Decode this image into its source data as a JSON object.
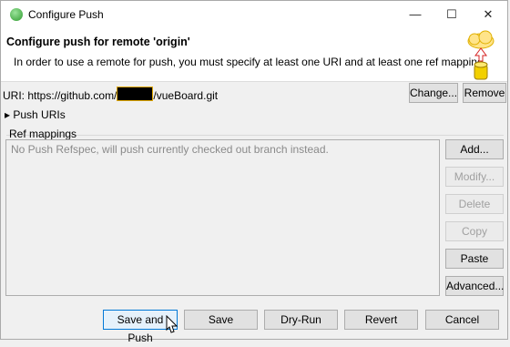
{
  "window": {
    "title": "Configure Push",
    "minimize": "—",
    "maximize": "☐",
    "close": "✕"
  },
  "header": {
    "title": "Configure push for remote 'origin'",
    "message": "In order to use a remote for push, you must specify at least one URI and at least one ref mapping"
  },
  "uri": {
    "label": "URI:",
    "prefix": "https://github.com/",
    "suffix": "/vueBoard.git",
    "change_label": "Change...",
    "remove_label": "Remove"
  },
  "push_uris": {
    "arrow": "▸",
    "label": "Push URIs"
  },
  "ref_mappings": {
    "label": "Ref mappings",
    "items": [
      "No Push Refspec, will push currently checked out branch instead."
    ],
    "buttons": {
      "add": "Add...",
      "modify": "Modify...",
      "delete": "Delete",
      "copy": "Copy",
      "paste": "Paste",
      "advanced": "Advanced..."
    }
  },
  "footer": {
    "save_and_push": "Save and Push",
    "save": "Save",
    "dry_run": "Dry-Run",
    "revert": "Revert",
    "cancel": "Cancel"
  }
}
